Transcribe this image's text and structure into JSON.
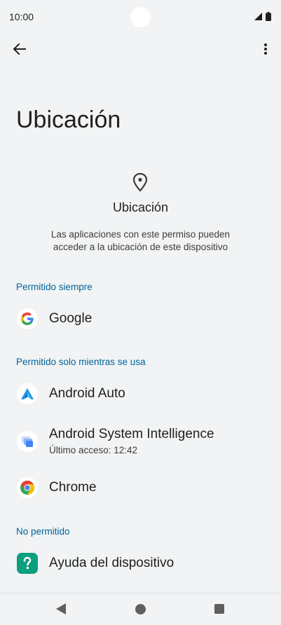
{
  "status": {
    "time": "10:00"
  },
  "header": {
    "page_title": "Ubicación",
    "icon": "location-pin-icon",
    "title": "Ubicación",
    "description_line1": "Las aplicaciones con este permiso pueden",
    "description_line2": "acceder a la ubicación de este dispositivo"
  },
  "sections": {
    "always": {
      "label": "Permitido siempre"
    },
    "while_in_use": {
      "label": "Permitido solo mientras se usa"
    },
    "denied": {
      "label": "No permitido"
    }
  },
  "apps": {
    "google": {
      "name": "Google",
      "icon": "google-icon"
    },
    "android_auto": {
      "name": "Android Auto",
      "icon": "android-auto-icon"
    },
    "asi": {
      "name": "Android System Intelligence",
      "subtitle": "Último acceso: 12:42",
      "icon": "android-system-intelligence-icon"
    },
    "chrome": {
      "name": "Chrome",
      "icon": "chrome-icon"
    },
    "help": {
      "name": "Ayuda del dispositivo",
      "icon": "help-icon"
    }
  },
  "colors": {
    "background": "#f1f3f4",
    "section_label": "#00639b",
    "text_primary": "#1f1f1f"
  }
}
